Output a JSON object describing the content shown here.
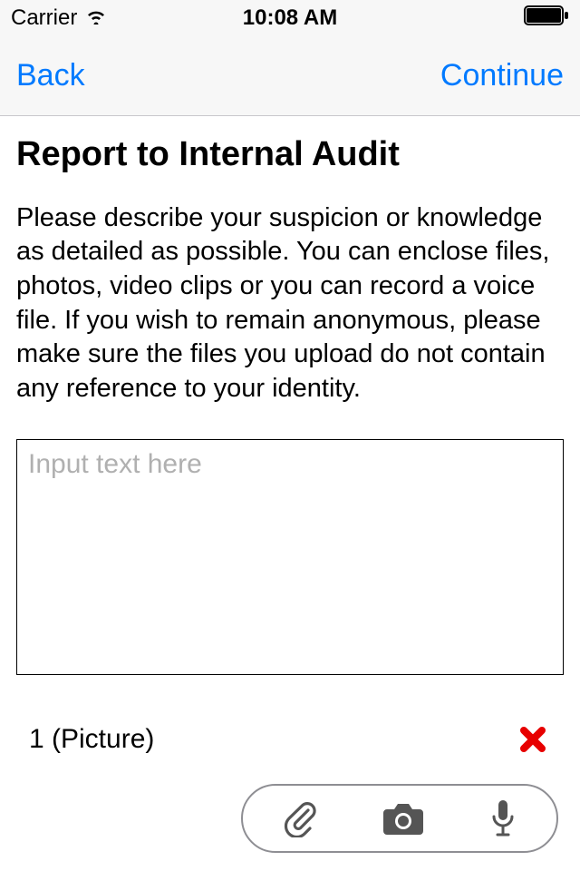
{
  "statusBar": {
    "carrier": "Carrier",
    "time": "10:08 AM"
  },
  "navBar": {
    "back": "Back",
    "continue": "Continue"
  },
  "page": {
    "title": "Report to Internal Audit",
    "description": "Please describe your suspicion or knowledge as detailed as possible. You can enclose files, photos, video clips or you can record a voice file. If you wish to remain anonymous, please make sure the files you upload do not contain any reference to your identity.",
    "inputPlaceholder": "Input text here",
    "inputValue": ""
  },
  "attachment": {
    "label": "1 (Picture)"
  },
  "icons": {
    "wifi": "wifi",
    "battery": "battery",
    "remove": "remove",
    "attach": "paperclip",
    "camera": "camera",
    "mic": "microphone"
  }
}
